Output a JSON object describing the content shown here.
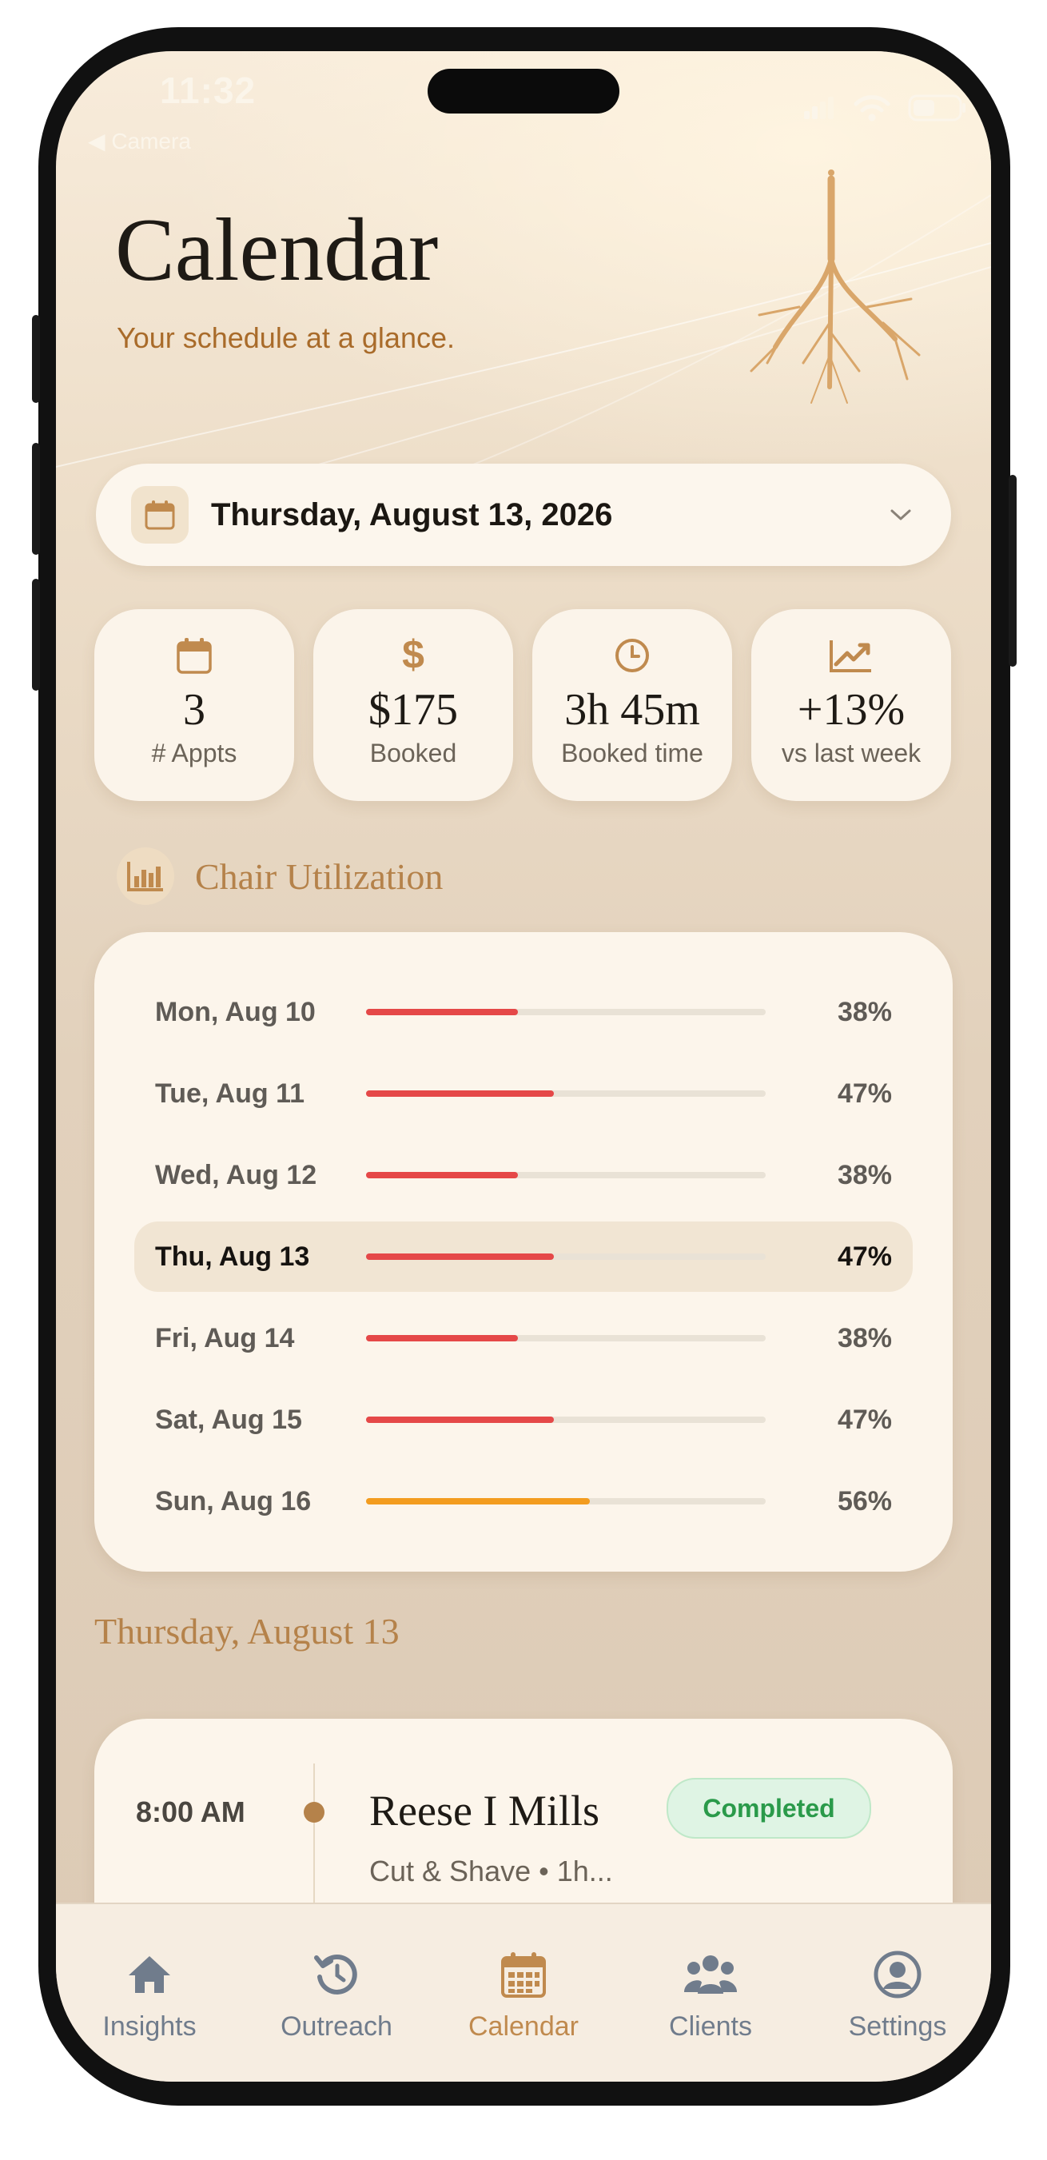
{
  "status_bar": {
    "time": "11:32",
    "back_label": "◀ Camera"
  },
  "header": {
    "title": "Calendar",
    "subtitle": "Your schedule at a glance."
  },
  "date_picker": {
    "label": "Thursday, August 13, 2026",
    "icon": "calendar-icon"
  },
  "stats": [
    {
      "icon": "calendar-icon",
      "value": "3",
      "label": "# Appts"
    },
    {
      "icon": "dollar-icon",
      "value": "$175",
      "label": "Booked"
    },
    {
      "icon": "clock-icon",
      "value": "3h 45m",
      "label": "Booked time"
    },
    {
      "icon": "trend-up-icon",
      "value": "+13%",
      "label": "vs last week"
    }
  ],
  "utilization": {
    "title": "Chair Utilization",
    "icon": "bar-chart-icon",
    "rows": [
      {
        "day": "Mon, Aug 10",
        "percent": "38%",
        "value": 38,
        "color": "#e54848",
        "selected": false
      },
      {
        "day": "Tue, Aug 11",
        "percent": "47%",
        "value": 47,
        "color": "#e54848",
        "selected": false
      },
      {
        "day": "Wed, Aug 12",
        "percent": "38%",
        "value": 38,
        "color": "#e54848",
        "selected": false
      },
      {
        "day": "Thu, Aug 13",
        "percent": "47%",
        "value": 47,
        "color": "#e54848",
        "selected": true
      },
      {
        "day": "Fri, Aug 14",
        "percent": "38%",
        "value": 38,
        "color": "#e54848",
        "selected": false
      },
      {
        "day": "Sat, Aug 15",
        "percent": "47%",
        "value": 47,
        "color": "#e54848",
        "selected": false
      },
      {
        "day": "Sun, Aug 16",
        "percent": "56%",
        "value": 56,
        "color": "#f39c1f",
        "selected": false
      }
    ]
  },
  "day_heading": "Thursday, August 13",
  "appointments": [
    {
      "time": "8:00 AM",
      "client": "Reese I Mills",
      "service": "Cut & Shave • 1h...",
      "status": "Completed",
      "status_color": "#2a9a4a"
    }
  ],
  "tabbar": [
    {
      "label": "Insights",
      "icon": "home-icon",
      "active": false
    },
    {
      "label": "Outreach",
      "icon": "history-icon",
      "active": false
    },
    {
      "label": "Calendar",
      "icon": "calendar-icon",
      "active": true
    },
    {
      "label": "Clients",
      "icon": "users-icon",
      "active": false
    },
    {
      "label": "Settings",
      "icon": "user-circle-icon",
      "active": false
    }
  ],
  "colors": {
    "accent": "#c08a4e",
    "subtitle": "#a96b2a",
    "low_util": "#e54848",
    "mid_util": "#f39c1f",
    "tab_inactive": "#707c8c"
  }
}
